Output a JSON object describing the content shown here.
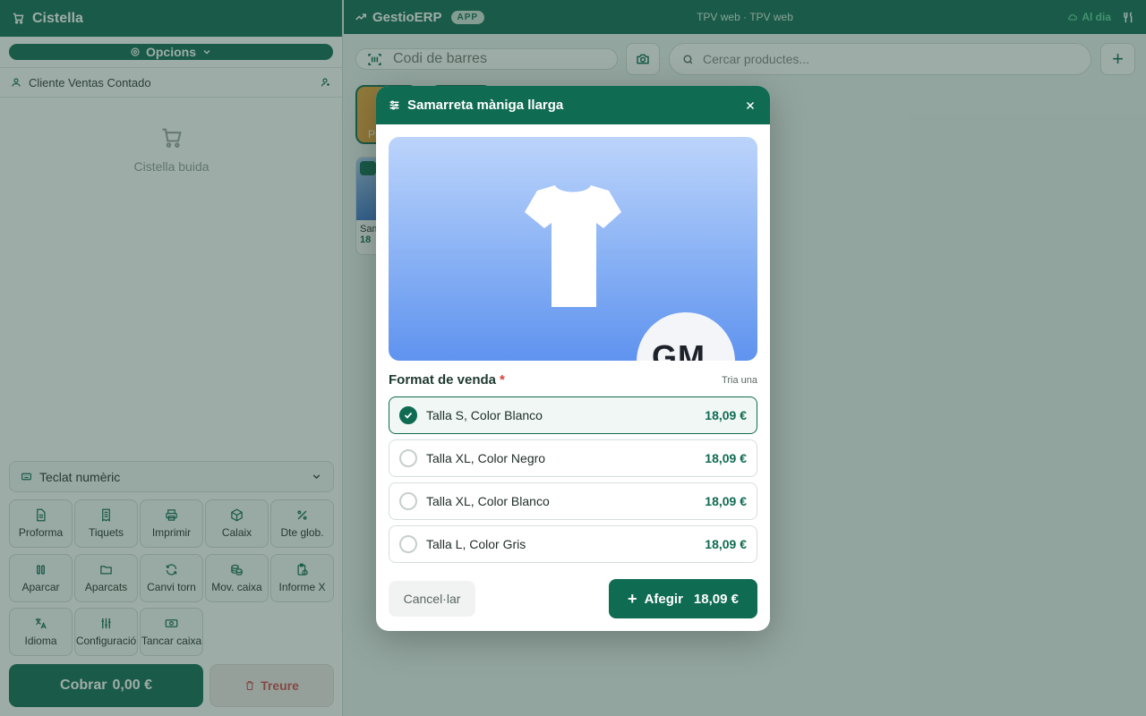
{
  "left": {
    "title": "Cistella",
    "options_label": "Opcions",
    "client": "Cliente Ventas Contado",
    "empty_cart": "Cistella buida",
    "numpad_label": "Teclat numèric",
    "actions": [
      {
        "label": "Proforma",
        "icon": "document-icon"
      },
      {
        "label": "Tiquets",
        "icon": "receipt-icon"
      },
      {
        "label": "Imprimir",
        "icon": "printer-icon"
      },
      {
        "label": "Calaix",
        "icon": "box-icon"
      },
      {
        "label": "Dte glob.",
        "icon": "percent-icon"
      },
      {
        "label": "Aparcar",
        "icon": "pause-icon"
      },
      {
        "label": "Aparcats",
        "icon": "folder-icon"
      },
      {
        "label": "Canvi torn",
        "icon": "refresh-icon"
      },
      {
        "label": "Mov. caixa",
        "icon": "coins-icon"
      },
      {
        "label": "Informe X",
        "icon": "clipboard-icon"
      },
      {
        "label": "Idioma",
        "icon": "language-icon"
      },
      {
        "label": "Configuració",
        "icon": "sliders-icon"
      },
      {
        "label": "Tancar caixa",
        "icon": "cash-icon"
      }
    ],
    "charge_label": "Cobrar",
    "charge_amount": "0,00 €",
    "remove_label": "Treure"
  },
  "topbar": {
    "brand": "GestioERP",
    "badge": "APP",
    "center": "TPV web · TPV web",
    "status": "Al dia"
  },
  "toolbar": {
    "barcode_placeholder": "Codi de barres",
    "search_placeholder": "Cercar productes..."
  },
  "background": {
    "category_label": "Pr",
    "product_name": "Sam",
    "product_price": "18"
  },
  "modal": {
    "title": "Samarreta màniga llarga",
    "image_logo_text": "GM",
    "format_label": "Format de venda",
    "required_mark": "*",
    "choose_hint": "Tria una",
    "options": [
      {
        "label": "Talla S, Color Blanco",
        "price": "18,09 €",
        "selected": true
      },
      {
        "label": "Talla XL, Color Negro",
        "price": "18,09 €",
        "selected": false
      },
      {
        "label": "Talla XL, Color Blanco",
        "price": "18,09 €",
        "selected": false
      },
      {
        "label": "Talla L, Color Gris",
        "price": "18,09 €",
        "selected": false
      }
    ],
    "cancel_label": "Cancel·lar",
    "add_label": "Afegir",
    "add_amount": "18,09 €"
  },
  "colors": {
    "primary": "#0f6b52",
    "accent_status": "#58d19c",
    "danger": "#d24b4b",
    "category_orange": "#e8a23a"
  }
}
